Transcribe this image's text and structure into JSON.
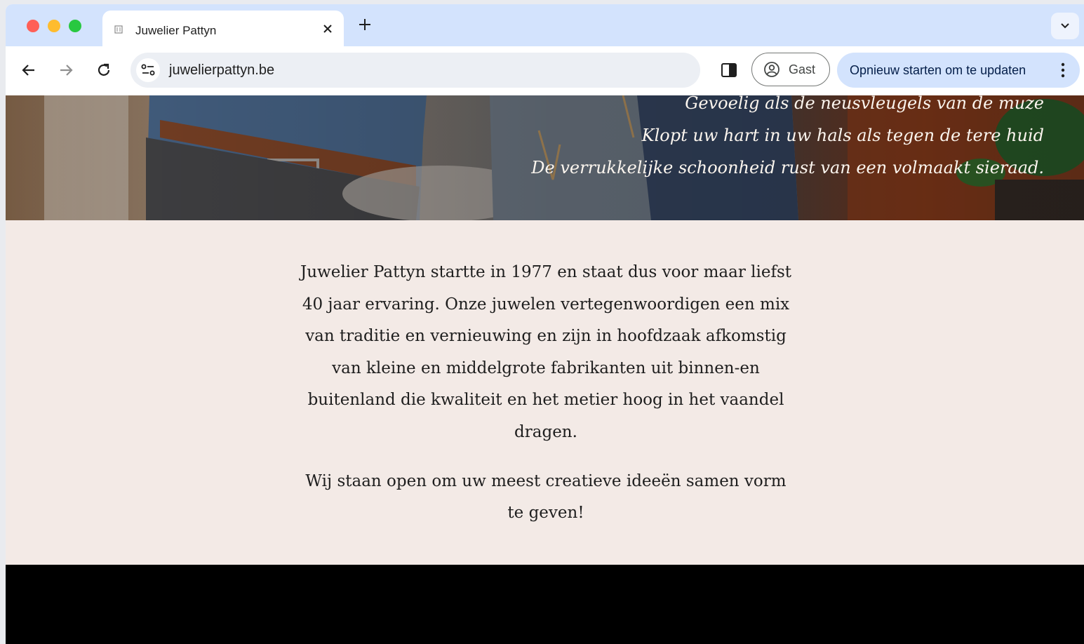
{
  "browser": {
    "tab": {
      "title": "Juwelier Pattyn"
    },
    "omnibox": {
      "url": "juwelierpattyn.be"
    },
    "profile": {
      "label": "Gast"
    },
    "update_button": {
      "label": "Opnieuw starten om te updaten"
    }
  },
  "hero": {
    "poem_lines": [
      "Gevoelig als de neusvleugels van de muze",
      "Klopt uw hart in uw hals als tegen de tere huid",
      "De verrukkelijke schoonheid rust van een volmaakt sieraad."
    ]
  },
  "intro": {
    "paragraph": "Juwelier Pattyn startte in 1977 en staat dus voor maar liefst 40 jaar ervaring. Onze juwelen vertegenwoordigen een mix van traditie en vernieuwing en zijn in hoofdzaak afkomstig van kleine en middelgrote fabrikanten uit binnen-en buitenland die kwaliteit en het metier hoog in het vaandel dragen.",
    "closing": "Wij staan open om uw meest creatieve ideeën samen vorm te geven!"
  },
  "colors": {
    "tabstrip": "#d3e3fd",
    "intro_background": "#f3eae6",
    "footer": "#000000"
  }
}
